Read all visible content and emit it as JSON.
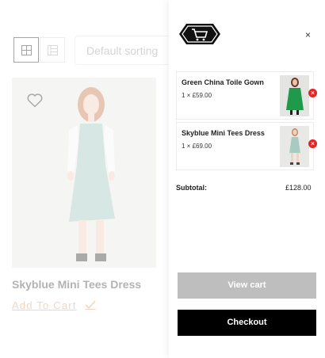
{
  "shop": {
    "sort_selected": "Default sorting",
    "product": {
      "name": "Skyblue Mini Tees Dress",
      "add_to_cart_label": "Add To Cart"
    },
    "icons": {
      "grid_view": "grid-view-icon",
      "list_view": "list-view-icon",
      "wishlist": "heart-icon",
      "added": "checkmark-icon"
    }
  },
  "mini_cart": {
    "icons": {
      "cart": "cart-icon",
      "close": "close-icon",
      "remove": "remove-icon"
    },
    "close_label": "×",
    "items": [
      {
        "title": "Green China Toile Gown",
        "qty_price": "1 × £59.00",
        "remove_label": "×"
      },
      {
        "title": "Skyblue Mini Tees Dress",
        "qty_price": "1 × £69.00",
        "remove_label": "×"
      }
    ],
    "subtotal_label": "Subtotal:",
    "subtotal_value": "£128.00",
    "view_cart_label": "View cart",
    "checkout_label": "Checkout"
  },
  "colors": {
    "accent": "#e5a074",
    "remove": "#e02828",
    "checkout_bg": "#000000",
    "view_cart_bg": "#bebebe"
  }
}
